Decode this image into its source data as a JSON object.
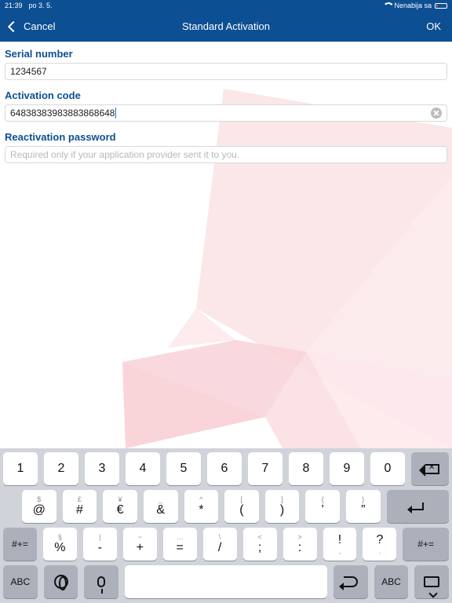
{
  "status": {
    "time": "21:39",
    "date": "po 3. 5.",
    "battery_label": "Nenabija sa"
  },
  "nav": {
    "back_label": "Cancel",
    "title": "Standard Activation",
    "ok_label": "OK"
  },
  "form": {
    "serial_label": "Serial number",
    "serial_value": "1234567",
    "activation_label": "Activation code",
    "activation_value": "64838383983883868648",
    "reactivation_label": "Reactivation password",
    "reactivation_placeholder": "Required only if your application provider sent it to you."
  },
  "keyboard": {
    "row1": [
      "1",
      "2",
      "3",
      "4",
      "5",
      "6",
      "7",
      "8",
      "9",
      "0"
    ],
    "row2": [
      {
        "main": "@",
        "top": "$"
      },
      {
        "main": "#",
        "top": "£"
      },
      {
        "main": "€",
        "top": "¥"
      },
      {
        "main": "&",
        "top": "_"
      },
      {
        "main": "*",
        "top": "^"
      },
      {
        "main": "(",
        "top": "["
      },
      {
        "main": ")",
        "top": "]"
      },
      {
        "main": "’",
        "top": "{"
      },
      {
        "main": "”",
        "top": "}"
      }
    ],
    "row3_left": "#+=",
    "row3": [
      {
        "main": "%",
        "top": "§"
      },
      {
        "main": "-",
        "top": "|"
      },
      {
        "main": "+",
        "top": "~"
      },
      {
        "main": "=",
        "top": "…"
      },
      {
        "main": "/",
        "top": "\\"
      },
      {
        "main": ";",
        "top": "<"
      },
      {
        "main": ":",
        "top": ">"
      },
      {
        "main": "!",
        "top": "",
        "sub": ","
      },
      {
        "main": "?",
        "top": "",
        "sub": "."
      }
    ],
    "row3_right": "#+=",
    "row4_abc_left": "ABC",
    "row4_abc_right": "ABC"
  },
  "icons": {
    "back": "chevron-left-icon",
    "clear": "clear-text-icon",
    "wifi": "wifi-icon",
    "battery": "battery-icon",
    "globe": "globe-icon",
    "mic": "microphone-icon",
    "undo": "undo-icon",
    "backspace": "backspace-icon",
    "return": "return-icon",
    "hide_keyboard": "hide-keyboard-icon"
  },
  "colors": {
    "primary": "#0d4f93",
    "label": "#0d4f93",
    "keyboard_bg": "#d0d3da",
    "accent_pattern": "#f7c9cf"
  }
}
